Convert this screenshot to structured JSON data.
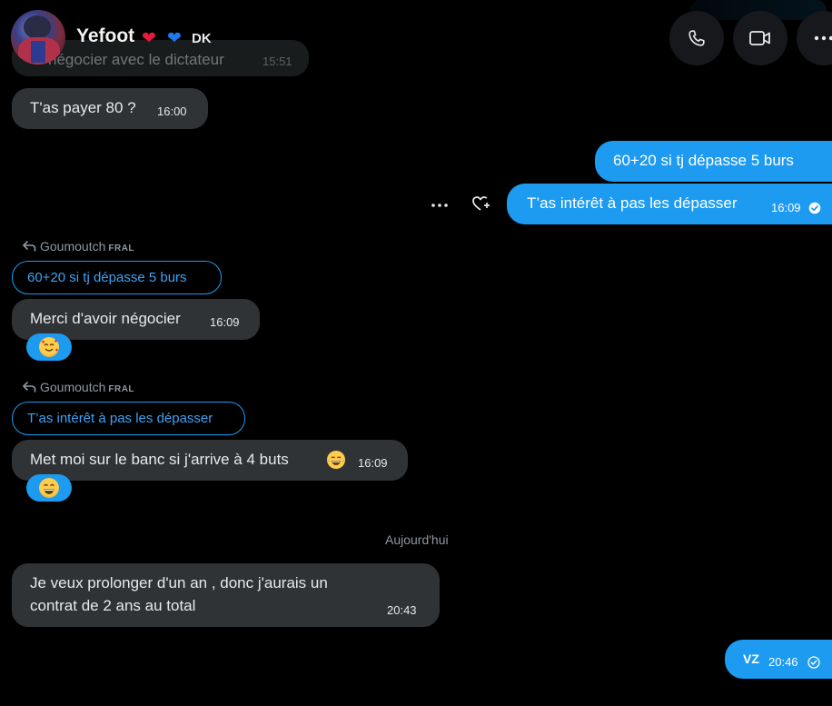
{
  "header": {
    "contact_name": "Yefoot",
    "name_suffix": "DK",
    "emojis": [
      "red-heart",
      "blue-heart"
    ]
  },
  "messages": [
    {
      "text": "négocier avec le dictateur",
      "time": "15:51"
    },
    {
      "text": "T'as payer 80 ?",
      "time": "16:00"
    },
    {
      "text": "60+20 si tj dépasse 5 burs"
    },
    {
      "text": "T’as intérêt à pas les dépasser",
      "time": "16:09"
    },
    {
      "reply_name": "Goumoutch",
      "reply_tag": "FRAL",
      "quote": "60+20 si tj dépasse 5 burs",
      "text": "Merci d'avoir négocier",
      "time": "16:09",
      "reaction": "smiling-face-with-hearts"
    },
    {
      "reply_name": "Goumoutch",
      "reply_tag": "FRAL",
      "quote": "T’as intérêt à pas les dépasser",
      "text": "Met moi sur le banc si j'arrive à 4 buts",
      "time": "16:09",
      "reaction": "grinning-face-with-tears"
    },
    {
      "text_line1": "Je veux prolonger d'un an , donc j'aurais un",
      "text_line2": "contrat de 2 ans au total",
      "time": "20:43"
    },
    {
      "text": "VZ",
      "time": "20:46"
    }
  ],
  "date_separator": "Aujourd'hui",
  "colors": {
    "accent": "#1d9bf0",
    "bubble_incoming": "#2f3336",
    "background": "#000000",
    "muted_text": "#8b98a5"
  }
}
